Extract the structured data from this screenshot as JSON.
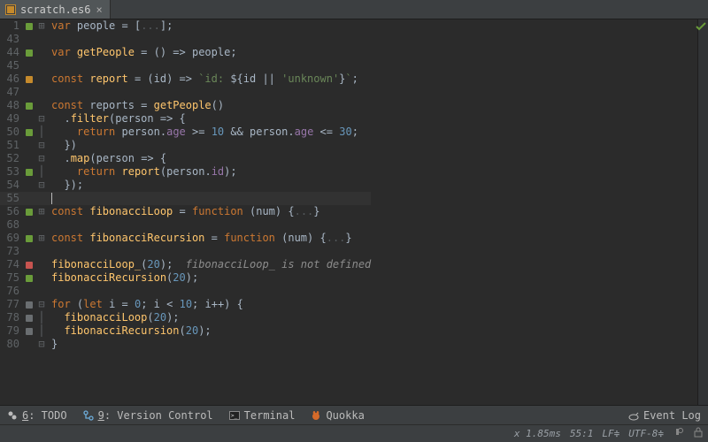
{
  "tab": {
    "title": "scratch.es6",
    "icon": "js-file-icon"
  },
  "editor": {
    "rows": [
      {
        "n": "1",
        "mark": "green",
        "fold": "+",
        "html": "<span class='kw'>var</span> <span class='ident'>people</span> = [<span class='folded'>...</span>];"
      },
      {
        "n": "43",
        "mark": "",
        "fold": "",
        "html": ""
      },
      {
        "n": "44",
        "mark": "green",
        "fold": "",
        "html": "<span class='kw'>var</span> <span class='fn'>getPeople</span> = () =&gt; <span class='ident'>people</span>;"
      },
      {
        "n": "45",
        "mark": "",
        "fold": "",
        "html": ""
      },
      {
        "n": "46",
        "mark": "orange",
        "fold": "",
        "html": "<span class='kw'>const</span> <span class='fn'>report</span> = (<span class='ident'>id</span>) =&gt; <span class='str'>`id: </span>${<span class='ident'>id</span> || <span class='str'>'unknown'</span>}<span class='str'>`</span>;"
      },
      {
        "n": "47",
        "mark": "",
        "fold": "",
        "html": ""
      },
      {
        "n": "48",
        "mark": "green",
        "fold": "",
        "html": "<span class='kw'>const</span> <span class='ident'>reports</span> = <span class='fn'>getPeople</span>()"
      },
      {
        "n": "49",
        "mark": "",
        "fold": "-",
        "html": "  .<span class='fn'>filter</span>(<span class='ident'>person</span> =&gt; {"
      },
      {
        "n": "50",
        "mark": "green",
        "fold": "|",
        "html": "    <span class='kw'>return</span> <span class='ident'>person</span>.<span class='prop'>age</span> &gt;= <span class='num'>10</span> &amp;&amp; <span class='ident'>person</span>.<span class='prop'>age</span> &lt;= <span class='num'>30</span>;"
      },
      {
        "n": "51",
        "mark": "",
        "fold": "-",
        "html": "  })"
      },
      {
        "n": "52",
        "mark": "",
        "fold": "-",
        "html": "  .<span class='fn'>map</span>(<span class='ident'>person</span> =&gt; {"
      },
      {
        "n": "53",
        "mark": "green",
        "fold": "|",
        "html": "    <span class='kw'>return</span> <span class='fn'>report</span>(<span class='ident'>person</span>.<span class='prop'>id</span>);"
      },
      {
        "n": "54",
        "mark": "",
        "fold": "-",
        "html": "  });"
      },
      {
        "n": "55",
        "mark": "",
        "fold": "",
        "hl": true,
        "html": "<span class='cursor'></span>"
      },
      {
        "n": "56",
        "mark": "green",
        "fold": "+",
        "html": "<span class='kw'>const</span> <span class='fn'>fibonacciLoop</span> = <span class='kw'>function</span> (<span class='ident'>num</span>) {<span class='folded'>...</span>}"
      },
      {
        "n": "68",
        "mark": "",
        "fold": "",
        "html": ""
      },
      {
        "n": "69",
        "mark": "green",
        "fold": "+",
        "html": "<span class='kw'>const</span> <span class='fn'>fibonacciRecursion</span> = <span class='kw'>function</span> (<span class='ident'>num</span>) {<span class='folded'>...</span>}"
      },
      {
        "n": "73",
        "mark": "",
        "fold": "",
        "html": ""
      },
      {
        "n": "74",
        "mark": "red",
        "fold": "",
        "html": "<span class='fn'>fibonacciLoop_</span>(<span class='num'>20</span>);  <span class='err'>fibonacciLoop_ is not defined</span>"
      },
      {
        "n": "75",
        "mark": "green",
        "fold": "",
        "html": "<span class='fn'>fibonacciRecursion</span>(<span class='num'>20</span>);"
      },
      {
        "n": "76",
        "mark": "",
        "fold": "",
        "html": ""
      },
      {
        "n": "77",
        "mark": "gray",
        "fold": "-",
        "html": "<span class='kw'>for</span> (<span class='kw'>let</span> <span class='ident'>i</span> = <span class='num'>0</span>; <span class='ident'>i</span> &lt; <span class='num'>10</span>; <span class='ident'>i</span>++) {"
      },
      {
        "n": "78",
        "mark": "gray",
        "fold": "|",
        "html": "  <span class='fn'>fibonacciLoop</span>(<span class='num'>20</span>);"
      },
      {
        "n": "79",
        "mark": "gray",
        "fold": "|",
        "html": "  <span class='fn'>fibonacciRecursion</span>(<span class='num'>20</span>);"
      },
      {
        "n": "80",
        "mark": "",
        "fold": "-",
        "html": "}"
      }
    ]
  },
  "toolstrip": {
    "todo": {
      "key": "6",
      "label": ": TODO"
    },
    "vcs": {
      "key": "9",
      "label": ": Version Control"
    },
    "terminal": "Terminal",
    "quokka": "Quokka",
    "eventlog": "Event Log"
  },
  "status": {
    "timing": "x 1.85ms",
    "caret": "55:1",
    "eol": "LF",
    "encoding": "UTF-8"
  },
  "colors": {
    "keyword": "#cc7832",
    "function": "#ffc66d",
    "property": "#9876aa",
    "number": "#6897bb",
    "string": "#6a8759",
    "error": "#8c8c8c",
    "marker_green": "#6a9c3a",
    "marker_orange": "#c58a2c",
    "marker_red": "#c75450",
    "marker_gray": "#6a6e71",
    "bg": "#2b2b2b",
    "chrome": "#3c3f41"
  }
}
